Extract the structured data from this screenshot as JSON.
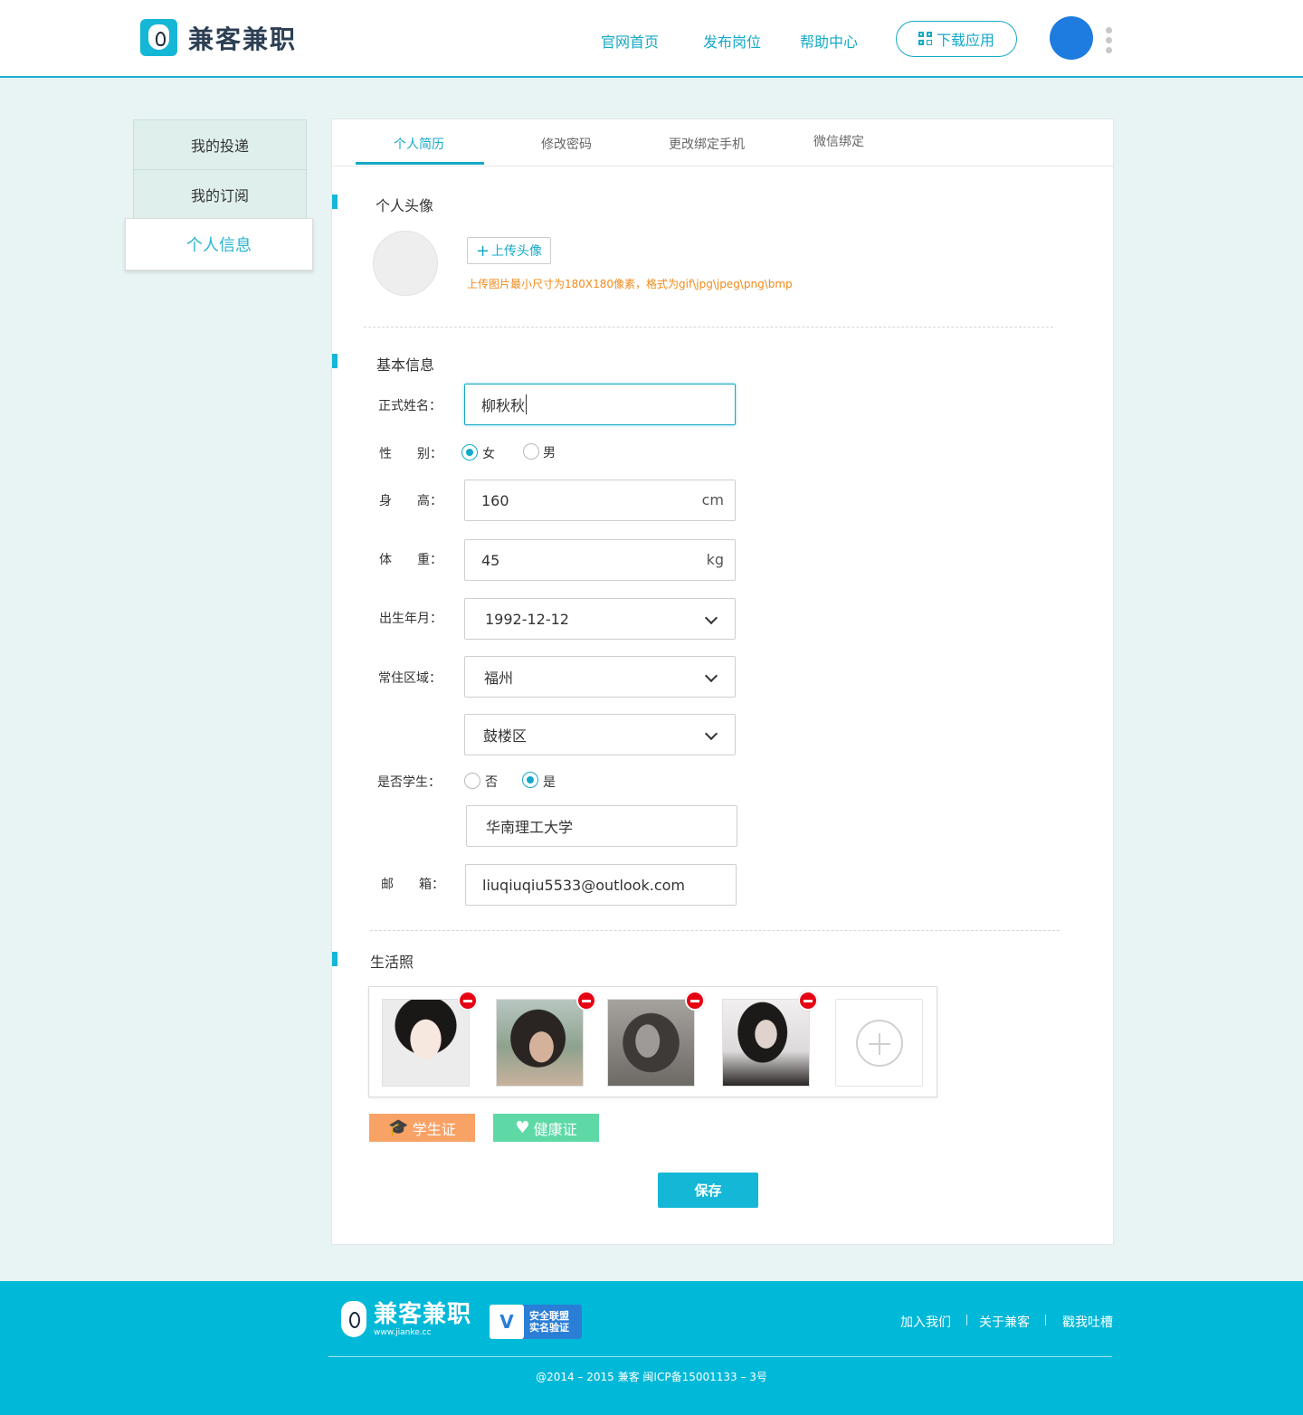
{
  "header": {
    "brand": "兼客兼职",
    "nav": [
      "官网首页",
      "发布岗位",
      "帮助中心"
    ],
    "download_label": "下载应用"
  },
  "sidebar": {
    "items": [
      {
        "label": "我的投递"
      },
      {
        "label": "我的订阅"
      },
      {
        "label": "个人信息",
        "active": true
      }
    ]
  },
  "tabs": [
    {
      "label": "个人简历",
      "active": true
    },
    {
      "label": "修改密码"
    },
    {
      "label": "更改绑定手机"
    },
    {
      "label": "微信绑定"
    }
  ],
  "avatar_section": {
    "title": "个人头像",
    "upload_label": "上传头像",
    "hint": "上传图片最小尺寸为180X180像素，格式为gif\\jpg\\jpeg\\png\\bmp"
  },
  "basic_info": {
    "title": "基本信息",
    "name_label": "正式姓名：",
    "name_value": "柳秋秋",
    "gender_label": "性　　别：",
    "gender_options": [
      "女",
      "男"
    ],
    "gender_selected": "女",
    "height_label": "身　　高：",
    "height_value": "160",
    "height_unit": "cm",
    "weight_label": "体　　重：",
    "weight_value": "45",
    "weight_unit": "kg",
    "birth_label": "出生年月：",
    "birth_value": "1992-12-12",
    "region_label": "常住区域：",
    "city_value": "福州",
    "district_value": "鼓楼区",
    "student_label": "是否学生：",
    "student_options": [
      "否",
      "是"
    ],
    "student_selected": "是",
    "school_value": "华南理工大学",
    "email_label": "邮　　箱：",
    "email_value": "liuqiuqiu5533@outlook.com"
  },
  "life_photos": {
    "title": "生活照",
    "count": 4
  },
  "badges": {
    "student": "学生证",
    "health": "健康证"
  },
  "save_label": "保存",
  "footer": {
    "brand": "兼客兼职",
    "domain": "www.jianke.cc",
    "verify_line1": "安全联盟",
    "verify_line2": "实名验证",
    "links": [
      "加入我们",
      "关于兼客",
      "戳我吐槽"
    ],
    "copyright": "@2014 – 2015  兼客  闽ICP备15001133 – 3号"
  },
  "colors": {
    "accent": "#14a9c8",
    "footer_bg": "#00b8d8",
    "hint": "#f08a1b",
    "delete": "#e60012",
    "student_badge": "#f9a266",
    "health_badge": "#5ed9a6"
  }
}
